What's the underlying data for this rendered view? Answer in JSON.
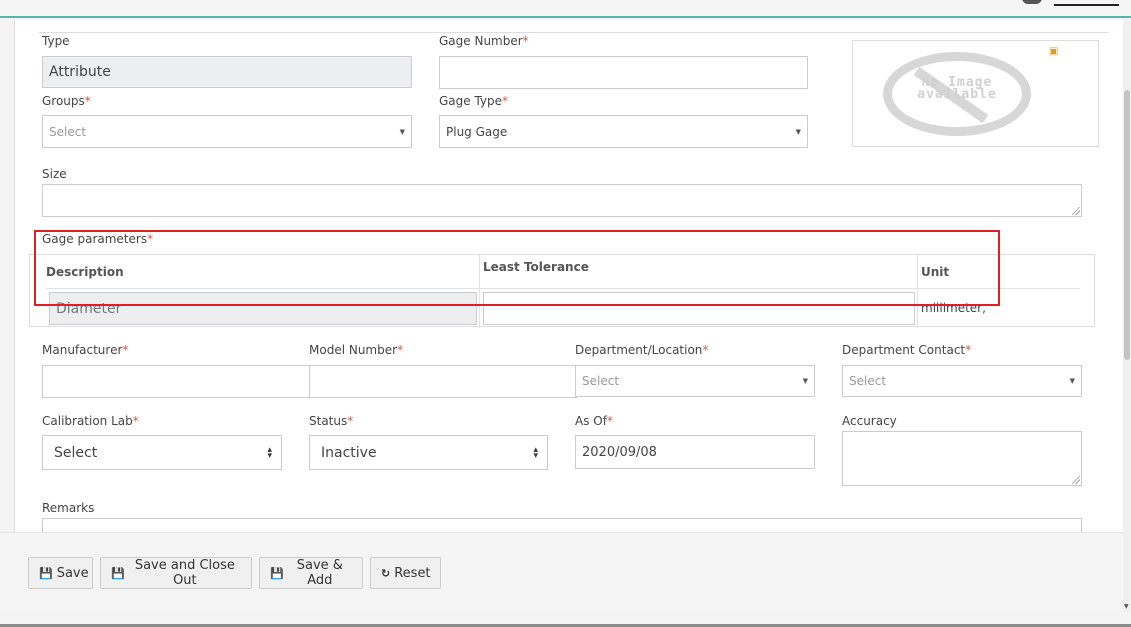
{
  "form": {
    "type": {
      "label": "Type",
      "value": "Attribute"
    },
    "gage_number": {
      "label": "Gage Number",
      "value": ""
    },
    "groups": {
      "label": "Groups",
      "placeholder": "Select"
    },
    "gage_type": {
      "label": "Gage Type",
      "value": "Plug Gage"
    },
    "size": {
      "label": "Size",
      "value": ""
    },
    "gage_parameters": {
      "label": "Gage parameters",
      "columns": [
        "Description",
        "Least Tolerance",
        "Unit"
      ],
      "rows": [
        {
          "description": "Diameter",
          "least_tolerance": "",
          "unit": "millimeter,"
        }
      ]
    },
    "manufacturer": {
      "label": "Manufacturer",
      "value": ""
    },
    "model_number": {
      "label": "Model Number",
      "value": ""
    },
    "department_location": {
      "label": "Department/Location",
      "placeholder": "Select"
    },
    "department_contact": {
      "label": "Department Contact",
      "placeholder": "Select"
    },
    "calibration_lab": {
      "label": "Calibration Lab",
      "value": "Select"
    },
    "status": {
      "label": "Status",
      "value": "Inactive"
    },
    "as_of": {
      "label": "As Of",
      "value": "2020/09/08"
    },
    "accuracy": {
      "label": "Accuracy",
      "value": ""
    },
    "remarks": {
      "label": "Remarks",
      "value": ""
    },
    "required_marker": "*"
  },
  "image": {
    "placeholder_text": "No Image available",
    "edit_icon": "image-edit-icon"
  },
  "buttons": {
    "save": "Save",
    "save_close": "Save and Close Out",
    "save_add": "Save & Add",
    "reset": "Reset"
  },
  "icons": {
    "save": "floppy-icon",
    "reset": "refresh-icon",
    "dropdown": "caret-down-icon"
  },
  "colors": {
    "required": "#d9534f",
    "highlight": "#e02020",
    "accent": "#5ab4ac"
  }
}
